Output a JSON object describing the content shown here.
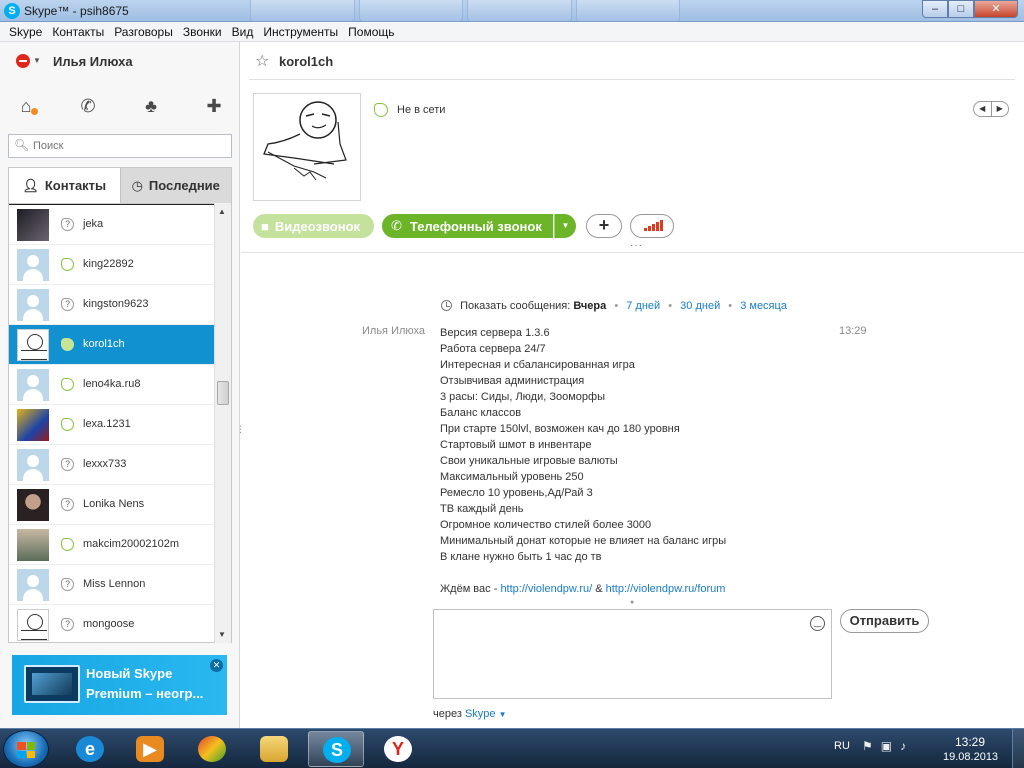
{
  "window": {
    "title": "Skype™ - psih8675",
    "app_icon_letter": "S"
  },
  "menu": [
    "Skype",
    "Контакты",
    "Разговоры",
    "Звонки",
    "Вид",
    "Инструменты",
    "Помощь"
  ],
  "profile": {
    "name": "Илья Илюха",
    "status": "do-not-disturb"
  },
  "search": {
    "placeholder": "Поиск"
  },
  "tabs": {
    "contacts": "Контакты",
    "recent": "Последние"
  },
  "contacts": [
    {
      "name": "jeka",
      "status": "unknown",
      "avatar": "photo"
    },
    {
      "name": "king22892",
      "status": "offline",
      "avatar": "default"
    },
    {
      "name": "kingston9623",
      "status": "unknown",
      "avatar": "default"
    },
    {
      "name": "korol1ch",
      "status": "offline",
      "avatar": "sketch",
      "selected": true
    },
    {
      "name": "leno4ka.ru8",
      "status": "offline",
      "avatar": "default"
    },
    {
      "name": "lexa.1231",
      "status": "offline",
      "avatar": "photo2"
    },
    {
      "name": "lexxx733",
      "status": "unknown",
      "avatar": "default"
    },
    {
      "name": "Lonika Nens",
      "status": "unknown",
      "avatar": "photo3"
    },
    {
      "name": "makcim20002102m",
      "status": "offline",
      "avatar": "photo4"
    },
    {
      "name": "Miss Lennon",
      "status": "unknown",
      "avatar": "default"
    },
    {
      "name": "mongoose",
      "status": "unknown",
      "avatar": "sketch"
    }
  ],
  "promo": {
    "line1": "Новый Skype",
    "line2": "Premium – неогр..."
  },
  "conversation": {
    "contact_name": "korol1ch",
    "status_text": "Не в сети",
    "buttons": {
      "video": "Видеозвонок",
      "phone": "Телефонный звонок"
    },
    "history": {
      "prefix": "Показать сообщения:",
      "current": "Вчера",
      "options": [
        "7 дней",
        "30 дней",
        "3 месяца"
      ]
    },
    "message": {
      "author": "Илья Илюха",
      "time": "13:29",
      "lines": [
        "Версия сервера 1.3.6",
        "Работа сервера 24/7",
        "Интересная и сбалансированная игра",
        "Отзывчивая администрация",
        "3 расы: Сиды, Люди, Зооморфы",
        "Баланс классов",
        "При старте 150lvl, возможен кач до 180 уровня",
        "Стартовый шмот в инвентаре",
        "Свои уникальные игровые валюты",
        "Максимальный уровень 250",
        "Ремесло 10 уровень,Ад/Рай 3",
        "ТВ каждый день",
        "Огромное количество стилей более 3000",
        "Минимальный донат которые не влияет на баланс игры",
        "В клане нужно быть 1 час до тв"
      ],
      "footer_prefix": "Ждём вас - ",
      "link1": "http://violendpw.ru/",
      "link_sep": " & ",
      "link2": "http://violendpw.ru/forum"
    },
    "send_label": "Отправить",
    "via_prefix": "через",
    "via_link": "Skype"
  },
  "taskbar": {
    "language": "RU",
    "time": "13:29",
    "date": "19.08.2013"
  }
}
